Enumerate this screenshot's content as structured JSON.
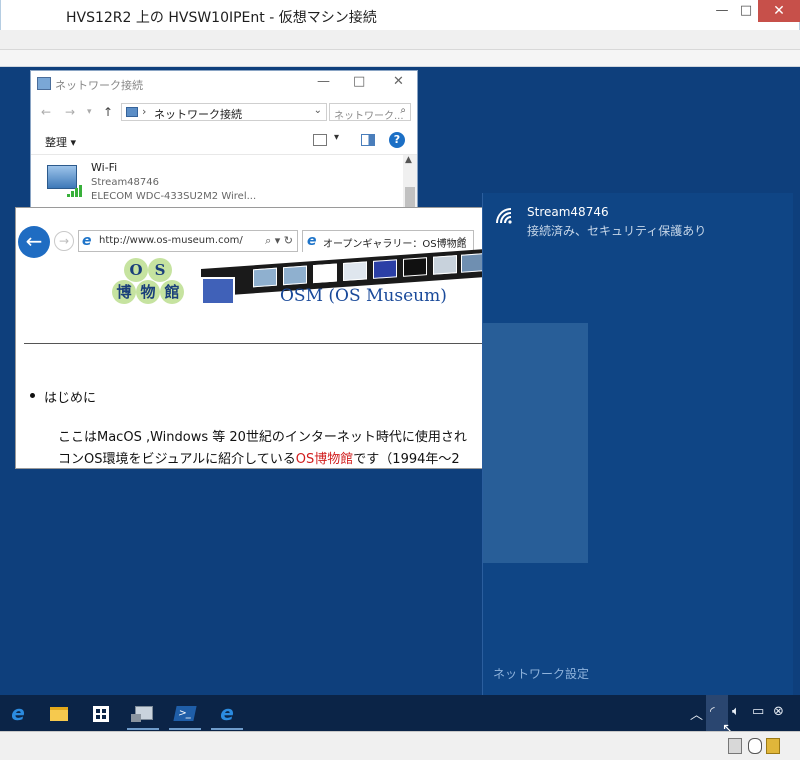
{
  "vm_window": {
    "title": "HVS12R2 上の HVSW10IPEnt  - 仮想マシン接続",
    "minimize_glyph": "—",
    "maximize_glyph": "□",
    "close_glyph": "✕"
  },
  "network_connections": {
    "title": "ネットワーク接続",
    "address": "ネットワーク接続",
    "search_placeholder": "ネットワーク...",
    "organize": "整理 ▾",
    "help": "?",
    "adapter": {
      "name": "Wi-Fi",
      "ssid": "Stream48746",
      "device": "ELECOM   WDC-433SU2M2  Wirel..."
    }
  },
  "ie": {
    "url": "http://www.os-museum.com/",
    "tab_title": "オープンギャラリー：OS博物館",
    "logo_chars": [
      "O",
      "S",
      "博",
      "物",
      "館"
    ],
    "site_title": "OSM (OS Museum)",
    "bullet": "はじめに",
    "paragraph_line1": "ここはMacOS ,Windows 等 20世紀のインターネット時代に使用され",
    "paragraph_line2_before": "コンOS環境をビジュアルに紹介している",
    "paragraph_line2_link": "OS博物館",
    "paragraph_line2_after": "です（1994年〜2"
  },
  "flyout": {
    "ssid": "Stream48746",
    "status": "接続済み、セキュリティ保護あり",
    "settings_link": "ネットワーク設定"
  },
  "taskbar": {
    "apps": [
      "edge-icon",
      "file-explorer-icon",
      "store-icon",
      "network-app-icon",
      "powershell-icon",
      "ie-icon"
    ],
    "tray": [
      "show-hidden-icon",
      "wifi-icon",
      "volume-icon",
      "action-center-icon",
      "close-icon"
    ]
  },
  "colors": {
    "desktop": "#0e3f7c",
    "flyout": "#0f4585",
    "taskbar": "#0b2447",
    "accent": "#1f6cc2",
    "link_red": "#d11d1d"
  }
}
